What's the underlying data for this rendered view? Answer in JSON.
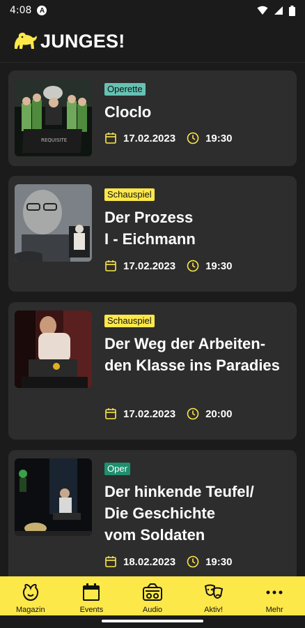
{
  "status": {
    "time": "4:08",
    "badge": "A"
  },
  "header": {
    "title": "JUNGES!"
  },
  "events": [
    {
      "category": "Operette",
      "title_lines": [
        "Cloclo"
      ],
      "date": "17.02.2023",
      "time": "19:30"
    },
    {
      "category": "Schauspiel",
      "title_lines": [
        "Der Prozess",
        "I - Eichmann"
      ],
      "date": "17.02.2023",
      "time": "19:30"
    },
    {
      "category": "Schauspiel",
      "title_lines": [
        "Der Weg der Arbeiten-",
        "den Klasse ins Paradies"
      ],
      "date": "17.02.2023",
      "time": "20:00"
    },
    {
      "category": "Oper",
      "title_lines": [
        "Der hinkende Teufel/",
        "Die Geschichte",
        "vom Soldaten"
      ],
      "date": "18.02.2023",
      "time": "19:30"
    }
  ],
  "nav": [
    {
      "label": "Magazin",
      "icon": "magazin-icon"
    },
    {
      "label": "Events",
      "icon": "calendar-icon"
    },
    {
      "label": "Audio",
      "icon": "radio-icon"
    },
    {
      "label": "Aktiv!",
      "icon": "theater-masks-icon"
    },
    {
      "label": "Mehr",
      "icon": "more-dots-icon"
    }
  ],
  "colors": {
    "accent": "#fde84a",
    "background": "#1b1b1b",
    "card": "#2d2d2d",
    "badge_operette": "#66c2b3",
    "badge_oper": "#1f8f6f"
  }
}
